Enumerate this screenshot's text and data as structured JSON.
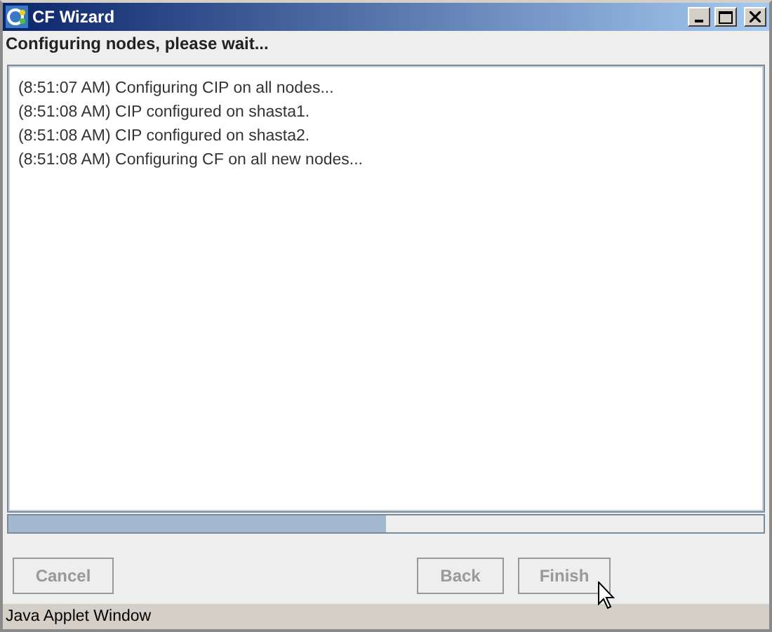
{
  "window": {
    "title": "CF Wizard"
  },
  "heading": "Configuring nodes, please wait...",
  "log": [
    "(8:51:07 AM) Configuring CIP on all nodes...",
    "(8:51:08 AM) CIP configured on shasta1.",
    "(8:51:08 AM) CIP configured on shasta2.",
    "(8:51:08 AM) Configuring CF on all new nodes..."
  ],
  "progress": {
    "level": 0.5
  },
  "buttons": [
    {
      "label": "Cancel",
      "disabled": true
    },
    {
      "label": "Back",
      "disabled": true
    },
    {
      "label": "Finish",
      "disabled": true
    }
  ],
  "status_bar": "Java Applet Window"
}
